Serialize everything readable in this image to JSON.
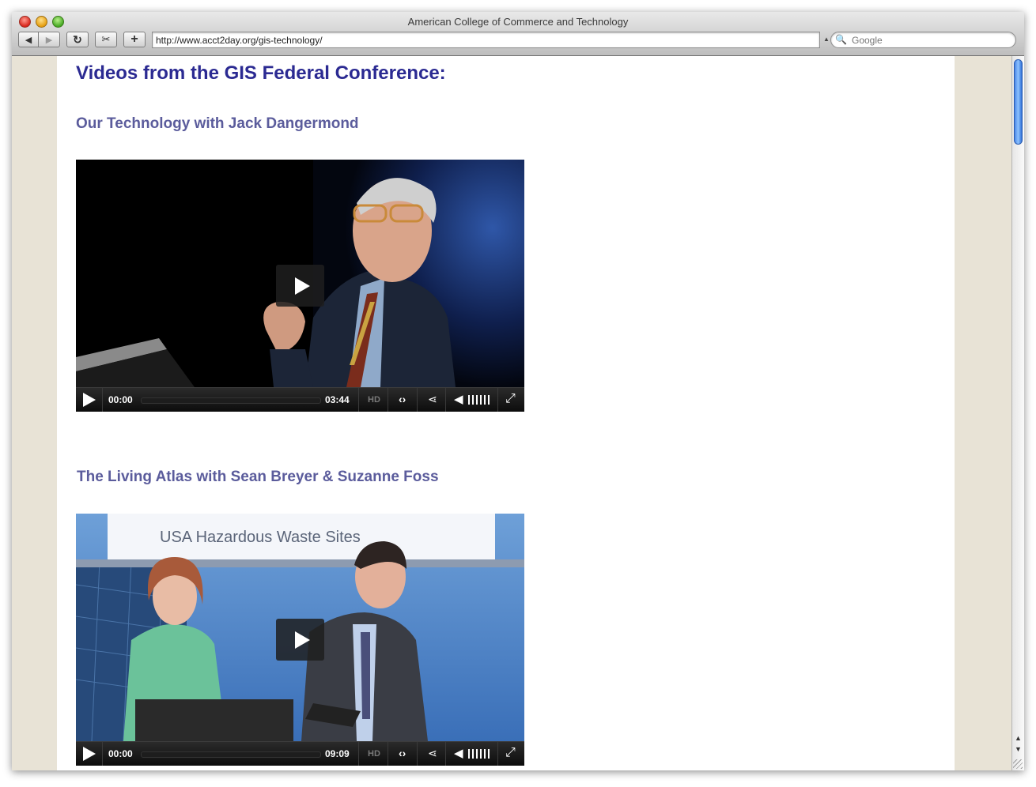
{
  "window": {
    "title": "American College of Commerce and Technology"
  },
  "toolbar": {
    "url": "http://www.acct2day.org/gis-technology/",
    "search_placeholder": "Google",
    "back_glyph": "◀",
    "forward_glyph": "▶",
    "reload_glyph": "↻",
    "snippet_glyph": "✂",
    "add_glyph": "+",
    "url_drop_glyph": "▲",
    "search_glyph": "🔍"
  },
  "page": {
    "title": "Videos from the GIS Federal Conference:",
    "videos": [
      {
        "title": "Our Technology with Jack Dangermond",
        "current_time": "00:00",
        "duration": "03:44"
      },
      {
        "title": "The Living Atlas with Sean Breyer & Suzanne Foss",
        "current_time": "00:00",
        "duration": "09:09"
      }
    ]
  },
  "player_controls": {
    "hd_label": "HD",
    "embed_glyph": "‹›",
    "share_glyph": "⋖",
    "volume_glyph": "◀",
    "fullscreen_glyph": "⤢"
  },
  "colors": {
    "page_title": "#2b2a92",
    "video_title": "#5b5c9c",
    "page_bg": "#e8e3d6"
  }
}
